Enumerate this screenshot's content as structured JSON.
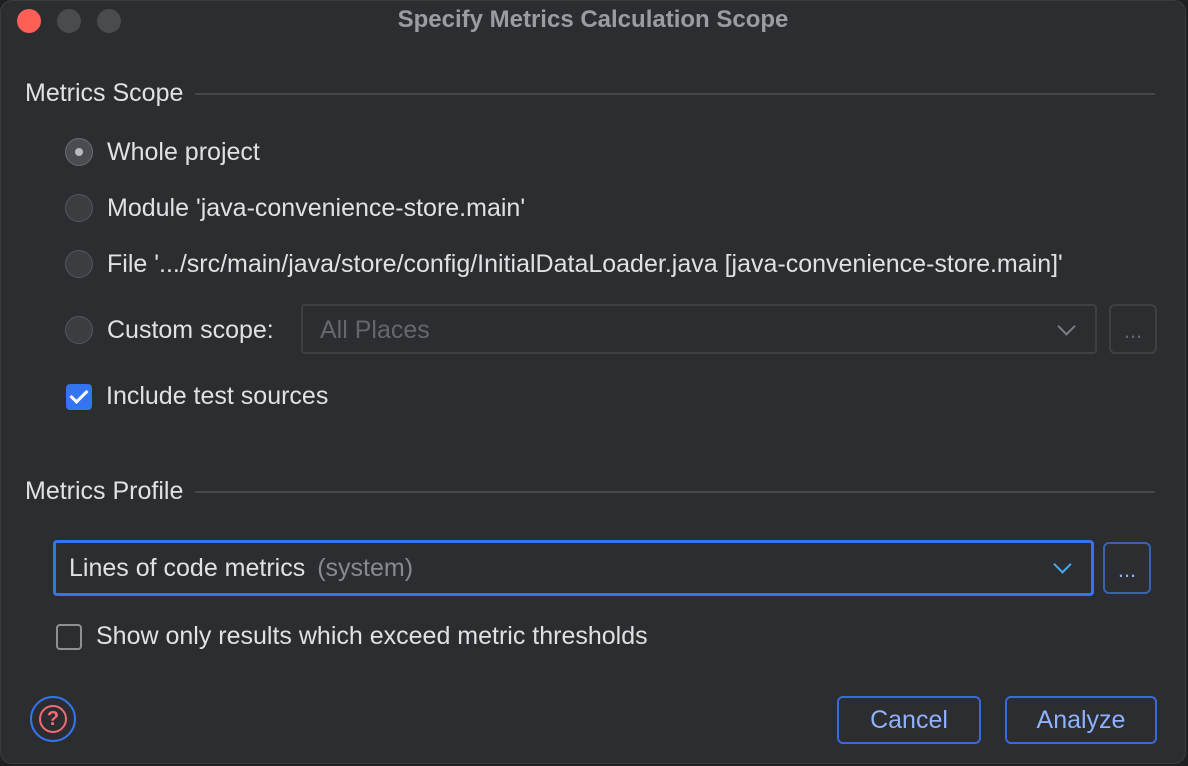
{
  "window": {
    "title": "Specify Metrics Calculation Scope"
  },
  "scope": {
    "header": "Metrics Scope",
    "options": [
      {
        "label": "Whole project",
        "selected": true
      },
      {
        "label": "Module 'java-convenience-store.main'",
        "selected": false
      },
      {
        "label": "File '.../src/main/java/store/config/InitialDataLoader.java [java-convenience-store.main]'",
        "selected": false
      },
      {
        "label": "Custom scope:",
        "selected": false
      }
    ],
    "custom_scope_value": "All Places",
    "custom_scope_more": "...",
    "include_tests": {
      "label": "Include test sources",
      "checked": true
    }
  },
  "profile": {
    "header": "Metrics Profile",
    "selected": "Lines of code metrics",
    "selected_suffix": "(system)",
    "more": "...",
    "exceed_only": {
      "label": "Show only results which exceed metric thresholds",
      "checked": false
    }
  },
  "footer": {
    "help_icon": "?",
    "cancel_label": "Cancel",
    "analyze_label": "Analyze"
  },
  "colors": {
    "accent": "#3574f0",
    "background": "#2b2d30",
    "close": "#fe5f57"
  }
}
